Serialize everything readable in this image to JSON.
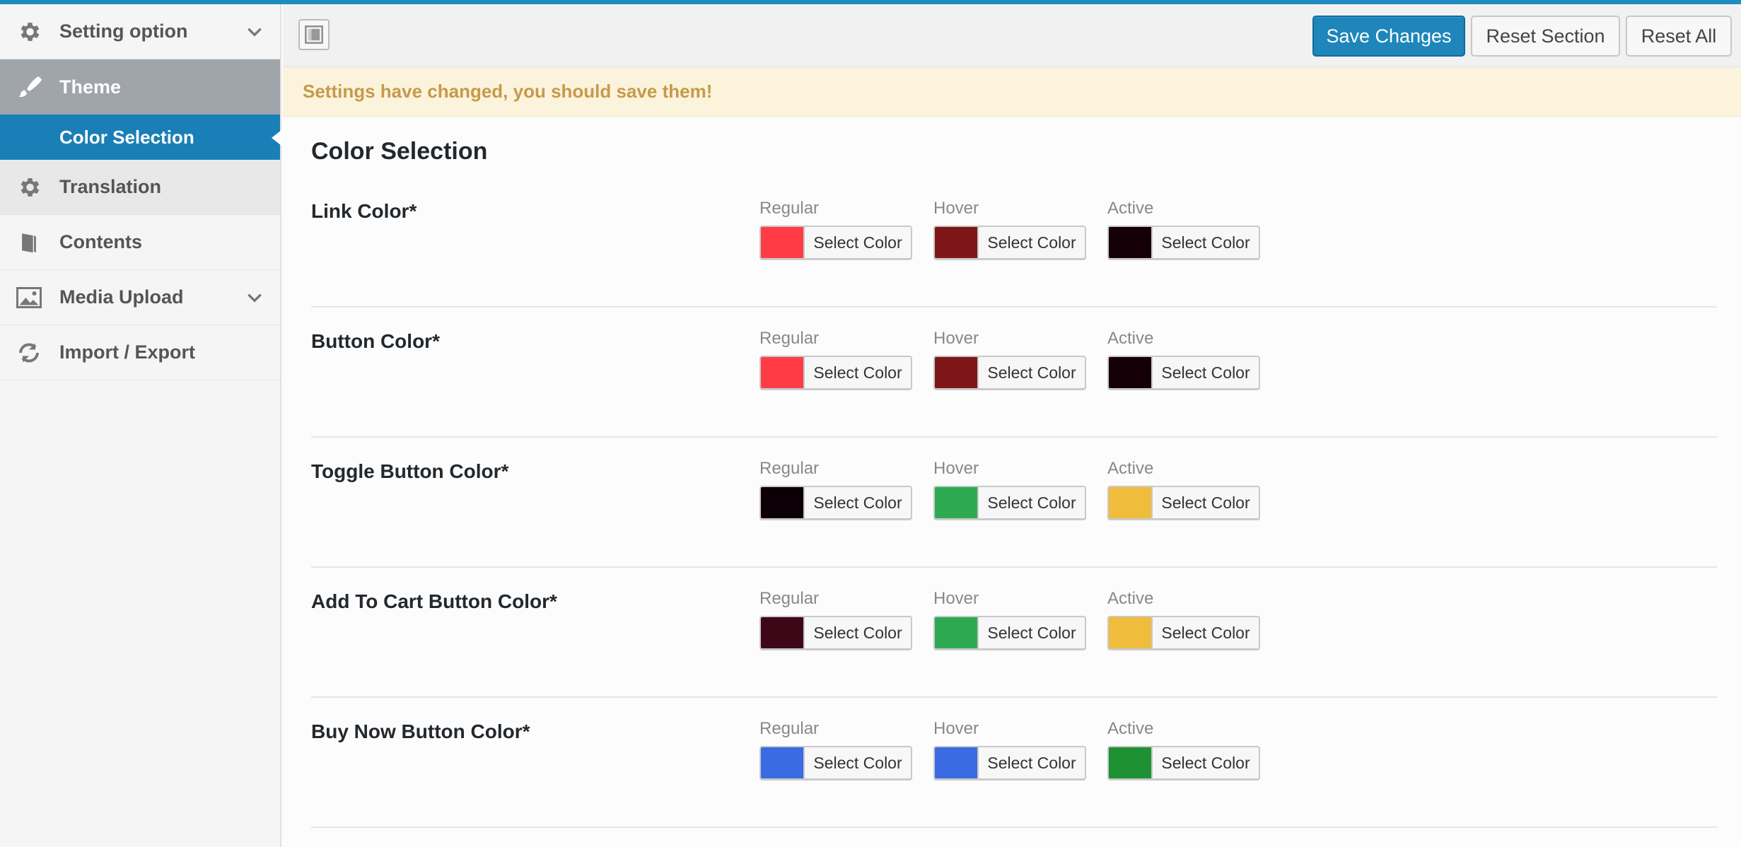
{
  "sidebar": {
    "items": [
      {
        "label": "Setting option",
        "icon": "gear-icon",
        "chevron": true
      },
      {
        "label": "Theme",
        "icon": "paintbrush-icon"
      },
      {
        "label": "Color Selection",
        "sub": true
      },
      {
        "label": "Translation",
        "icon": "gear-icon"
      },
      {
        "label": "Contents",
        "icon": "book-icon"
      },
      {
        "label": "Media Upload",
        "icon": "image-icon",
        "chevron": true
      },
      {
        "label": "Import / Export",
        "icon": "refresh-icon"
      }
    ]
  },
  "toolbar": {
    "save_label": "Save Changes",
    "reset_section_label": "Reset Section",
    "reset_all_label": "Reset All"
  },
  "notice": "Settings have changed, you should save them!",
  "section_title": "Color Selection",
  "select_label": "Select Color",
  "state_labels": {
    "regular": "Regular",
    "hover": "Hover",
    "active": "Active"
  },
  "rows": [
    {
      "label": "Link Color*",
      "regular": "#ff3c45",
      "hover": "#7e1617",
      "active": "#140006"
    },
    {
      "label": "Button Color*",
      "regular": "#ff3c45",
      "hover": "#7e1617",
      "active": "#140006"
    },
    {
      "label": "Toggle Button Color*",
      "regular": "#0c0006",
      "hover": "#2daa51",
      "active": "#f0bc3c"
    },
    {
      "label": "Add To Cart Button Color*",
      "regular": "#3e0718",
      "hover": "#2daa51",
      "active": "#f0bc3c"
    },
    {
      "label": "Buy Now Button Color*",
      "regular": "#3b6be3",
      "hover": "#3b6be3",
      "active": "#1d9133"
    }
  ]
}
